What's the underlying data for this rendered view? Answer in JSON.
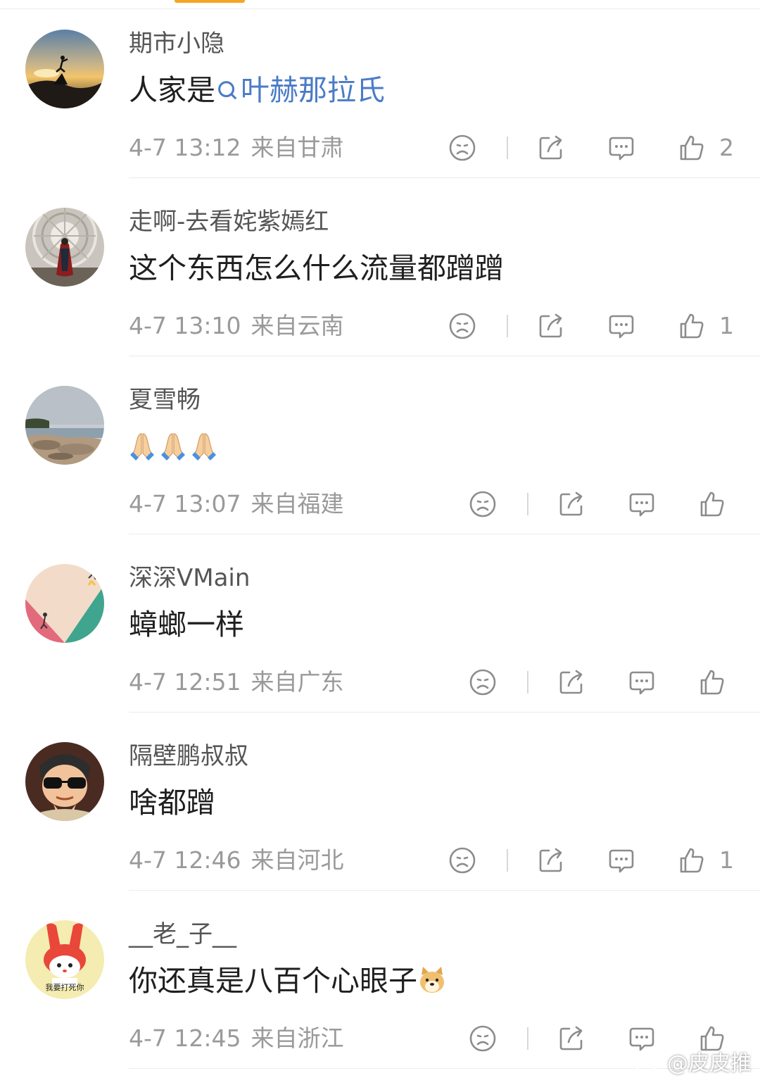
{
  "colors": {
    "topic_link": "#4a7bc8",
    "meta_text": "#9a9a9a",
    "icon_stroke": "#8c8c8c",
    "tab_accent": "#f5a623"
  },
  "comments": [
    {
      "username": "期市小隐",
      "content_prefix": "人家是",
      "topic": "叶赫那拉氏",
      "time": "4-7 13:12",
      "location": "来自甘肃",
      "likes": "2",
      "avatar": "sunset-silhouette-avatar"
    },
    {
      "username": "走啊-去看姹紫嫣红",
      "content": "这个东西怎么什么流量都蹭蹭",
      "time": "4-7 13:10",
      "location": "来自云南",
      "likes": "1",
      "avatar": "doctor-strange-avatar"
    },
    {
      "username": "夏雪畅",
      "emoji": [
        "folded-hands-emoji",
        "folded-hands-emoji",
        "folded-hands-emoji"
      ],
      "time": "4-7 13:07",
      "location": "来自福建",
      "likes": "",
      "avatar": "seaside-rocks-avatar"
    },
    {
      "username": "深深VMain",
      "content": "蟑螂一样",
      "time": "4-7 12:51",
      "location": "来自广东",
      "likes": "",
      "avatar": "climbers-geometric-avatar"
    },
    {
      "username": "隔壁鹏叔叔",
      "content": "啥都蹭",
      "time": "4-7 12:46",
      "location": "来自河北",
      "likes": "1",
      "avatar": "cartoon-boy-glasses-avatar"
    },
    {
      "username": "__老_子__",
      "content": "你还真是八百个心眼子",
      "inline_emoji": "doge-emoji",
      "time": "4-7 12:45",
      "location": "来自浙江",
      "likes": "",
      "avatar": "red-rabbit-avatar",
      "avatar_text": "我要打死你"
    }
  ],
  "watermark": {
    "text": "@皮皮推",
    "icon": "weibo-logo-icon"
  }
}
